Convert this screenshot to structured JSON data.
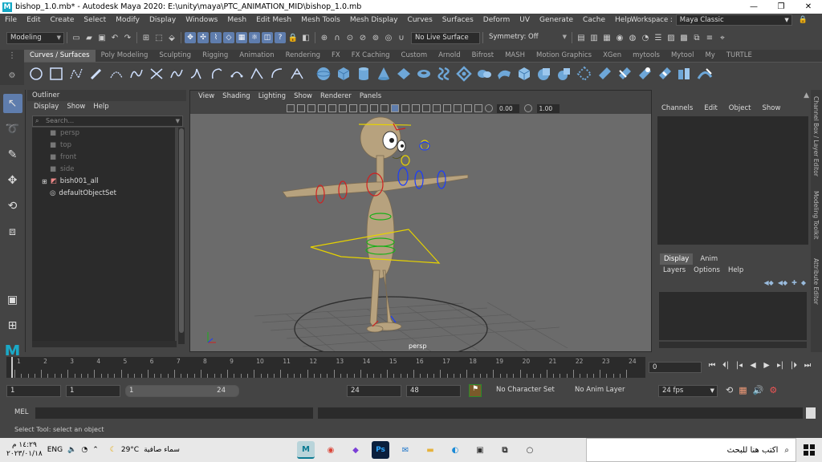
{
  "window": {
    "title": "bishop_1.0.mb* - Autodesk Maya 2020: E:\\unity\\maya\\PTC_ANIMATION_MID\\bishop_1.0.mb",
    "minimize": "—",
    "maximize": "❐",
    "close": "✕"
  },
  "menubar": {
    "items": [
      "File",
      "Edit",
      "Create",
      "Select",
      "Modify",
      "Display",
      "Windows",
      "Mesh",
      "Edit Mesh",
      "Mesh Tools",
      "Mesh Display",
      "Curves",
      "Surfaces",
      "Deform",
      "UV",
      "Generate",
      "Cache",
      "Help"
    ],
    "workspace_label": "Workspace :",
    "workspace_value": "Maya Classic"
  },
  "statusline": {
    "mode": "Modeling",
    "live_surface": "No Live Surface",
    "symmetry": "Symmetry: Off"
  },
  "shelf": {
    "tabs": [
      "Curves / Surfaces",
      "Poly Modeling",
      "Sculpting",
      "Rigging",
      "Animation",
      "Rendering",
      "FX",
      "FX Caching",
      "Custom",
      "Arnold",
      "Bifrost",
      "MASH",
      "Motion Graphics",
      "XGen",
      "mytools",
      "Mytool",
      "My",
      "TURTLE"
    ],
    "active_tab": "Curves / Surfaces"
  },
  "outliner": {
    "title": "Outliner",
    "menu": [
      "Display",
      "Show",
      "Help"
    ],
    "search_placeholder": "Search...",
    "items": [
      {
        "label": "persp",
        "dim": true
      },
      {
        "label": "top",
        "dim": true
      },
      {
        "label": "front",
        "dim": true
      },
      {
        "label": "side",
        "dim": true
      },
      {
        "label": "bish001_all",
        "dim": false
      },
      {
        "label": "defaultObjectSet",
        "dim": false
      }
    ]
  },
  "viewport": {
    "menu": [
      "View",
      "Shading",
      "Lighting",
      "Show",
      "Renderer",
      "Panels"
    ],
    "value_a": "0.00",
    "value_b": "1.00",
    "camera_label": "persp"
  },
  "channelbox": {
    "menu": [
      "Channels",
      "Edit",
      "Object",
      "Show"
    ],
    "side_tabs": [
      "Channel Box / Layer Editor",
      "Modeling Toolkit",
      "Attribute Editor"
    ]
  },
  "layers": {
    "tabs": [
      "Display",
      "Anim"
    ],
    "active": "Display",
    "menu": [
      "Layers",
      "Options",
      "Help"
    ]
  },
  "timeslider": {
    "ticks": [
      "1",
      "2",
      "3",
      "4",
      "5",
      "6",
      "7",
      "8",
      "9",
      "10",
      "11",
      "12",
      "13",
      "14",
      "15",
      "16",
      "17",
      "18",
      "19",
      "20",
      "21",
      "22",
      "23",
      "24"
    ],
    "current_frame": "0"
  },
  "range": {
    "start": "1",
    "start_inner": "1",
    "range_start": "1",
    "range_end": "24",
    "end_inner": "24",
    "end": "48",
    "character_set": "No Character Set",
    "anim_layer": "No Anim Layer",
    "fps": "24 fps"
  },
  "cmdline": {
    "label": "MEL",
    "help": "Select Tool: select an object"
  },
  "taskbar": {
    "time": "١٤:٢٩ م",
    "date": "٢٠٢٣/٠١/١٨",
    "lang": "ENG",
    "temp": "29°C",
    "weather": "سماء صافية",
    "search_placeholder": "اكتب هنا للبحث"
  }
}
